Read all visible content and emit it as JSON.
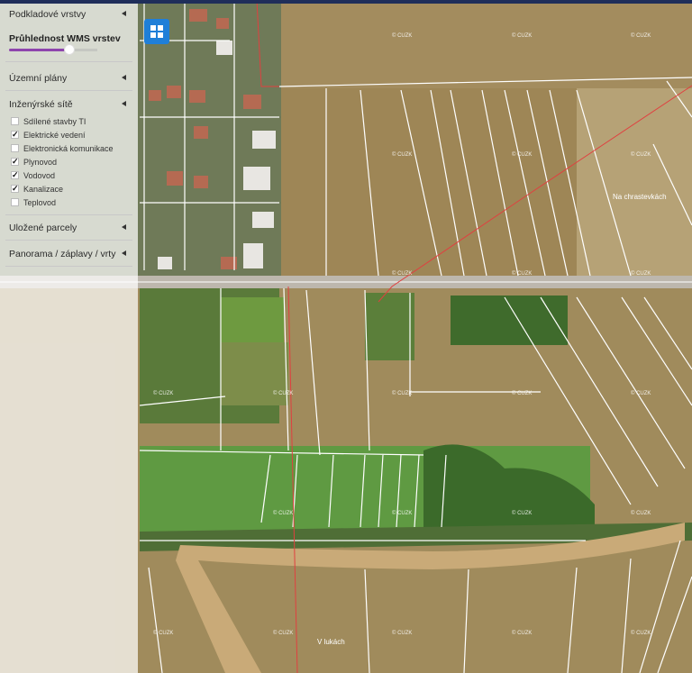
{
  "sidebar": {
    "basemap_section": "Podkladové vrstvy",
    "opacity_label": "Průhlednost WMS vrstev",
    "opacity_value": 0.65,
    "zoning_section": "Územní plány",
    "utilities_section": "Inženýrské sítě",
    "utilities": [
      {
        "label": "Sdílené stavby TI",
        "checked": false
      },
      {
        "label": "Elektrické vedení",
        "checked": true
      },
      {
        "label": "Elektronická komunikace",
        "checked": false
      },
      {
        "label": "Plynovod",
        "checked": true
      },
      {
        "label": "Vodovod",
        "checked": true
      },
      {
        "label": "Kanalizace",
        "checked": true
      },
      {
        "label": "Teplovod",
        "checked": false
      }
    ],
    "saved_parcels_section": "Uložené parcely",
    "panorama_section": "Panorama / záplavy / vrty"
  },
  "map": {
    "place_labels": [
      "Na chrastevkách",
      "V lukách"
    ],
    "watermark": "© ČÚZK",
    "check_mark": "✓",
    "colors": {
      "field": "#a08b5c",
      "meadow": "#5f8a3a",
      "parcel_line": "#ffffff",
      "power_line": "#e04040",
      "road": "#bdb7ad"
    }
  },
  "toolbar": {
    "layers_button_icon": "grid-icon"
  }
}
